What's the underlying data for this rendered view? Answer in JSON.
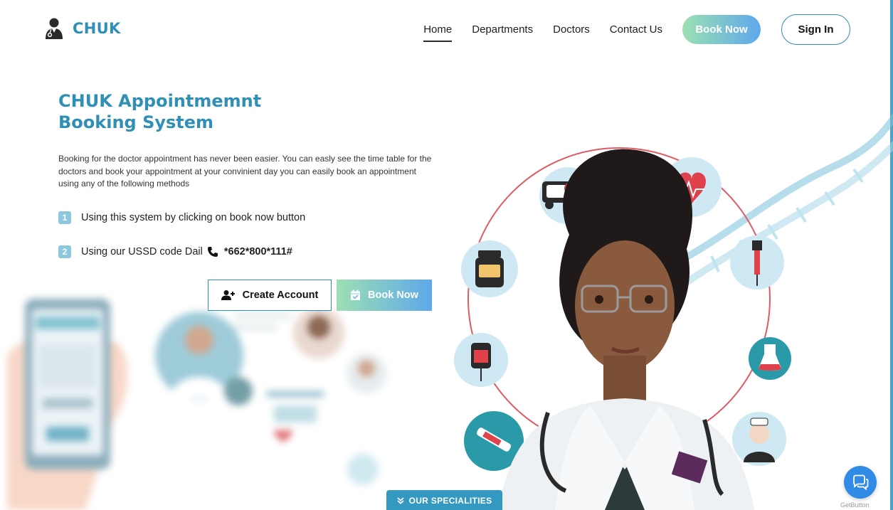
{
  "brand": {
    "name": "CHUK",
    "icon": "doctor-icon"
  },
  "nav": {
    "items": [
      {
        "label": "Home",
        "active": true
      },
      {
        "label": "Departments"
      },
      {
        "label": "Doctors"
      },
      {
        "label": "Contact Us"
      }
    ],
    "book_now": "Book Now",
    "sign_in": "Sign In"
  },
  "hero": {
    "title_line1": "CHUK Appointmemnt",
    "title_line2": "Booking System",
    "description": "Booking for the doctor appointment has never been easier. You can easly see the time table for the doctors and book your appointment at your convinient day you can easily book an appointment using any of the following methods",
    "methods": [
      {
        "number": "1",
        "text": "Using this system by clicking on book now button"
      },
      {
        "number": "2",
        "text": "Using our USSD code Dail",
        "icon": "phone-icon",
        "code": "*662*800*111#"
      }
    ],
    "create_account": "Create Account",
    "book_now": "Book Now"
  },
  "specialities": {
    "label": "OUR SPECIALITIES",
    "icon": "double-chevron-down-icon"
  },
  "chat": {
    "icon": "chat-icon",
    "getbutton_label": "GetButton"
  },
  "colors": {
    "brand": "#2f8fb7",
    "gradient_start": "#9ce0b1",
    "gradient_end": "#5ea8ec",
    "accent": "#3399c1"
  }
}
